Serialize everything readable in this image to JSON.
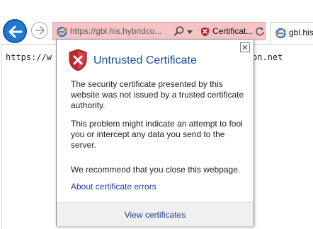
{
  "toolbar": {
    "address_url": "https://gbl.his.hybridco...",
    "cert_error_label": "Certificat...",
    "tab_title": "gbl.his"
  },
  "page": {
    "text_left": "https://w",
    "text_right": "on.net"
  },
  "flyout": {
    "title": "Untrusted Certificate",
    "paragraph_1": "The security certificate presented by this website was not issued by a trusted certificate authority.",
    "paragraph_2": "This problem might indicate an attempt to fool you or intercept any data you send to the server.",
    "paragraph_3": "We recommend that you close this webpage.",
    "about_link": "About certificate errors",
    "view_link": "View certificates"
  },
  "icons": {
    "back": "back-arrow-icon",
    "forward": "forward-arrow-icon",
    "site": "ie-logo-icon",
    "search": "search-icon",
    "cert_error": "certificate-error-shield-icon",
    "refresh": "refresh-icon",
    "close": "close-icon",
    "warning_shield": "warning-shield-icon"
  },
  "colors": {
    "address_bar_error": "#f6c3c6",
    "back_button": "#1e79d1",
    "link": "#1b3f9a",
    "title": "#1f4f8f",
    "shield_red": "#c0282d"
  }
}
